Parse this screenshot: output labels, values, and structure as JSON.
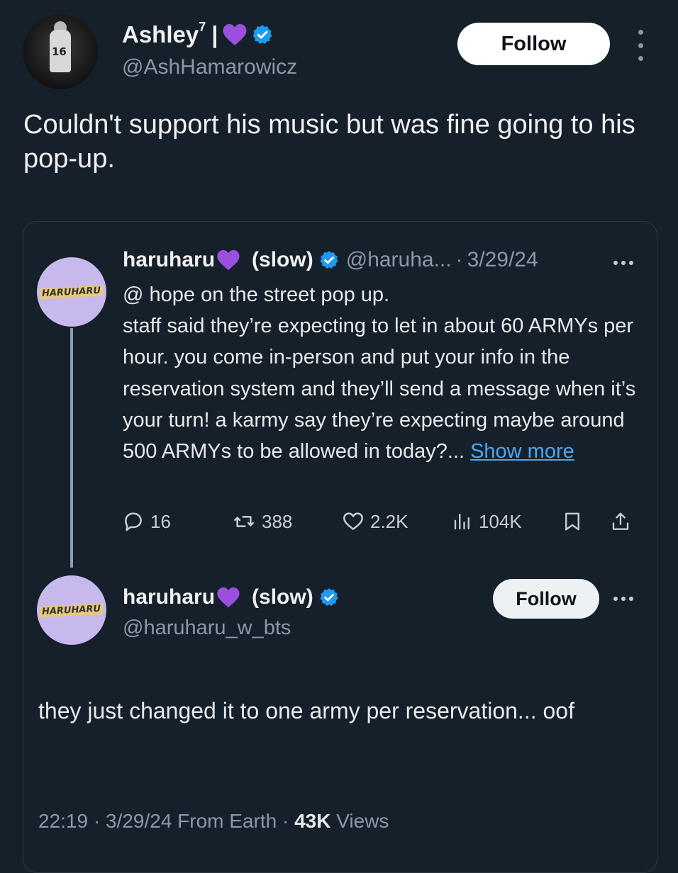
{
  "author": {
    "name": "Ashley",
    "superscript": "7",
    "separator": "|",
    "handle": "@AshHamarowicz",
    "avatar_text": "16",
    "follow_label": "Follow"
  },
  "tweet": {
    "text": "Couldn't support his music but was fine going to his pop-up.",
    "meta": {
      "time": "22:19",
      "date": "3/29/24",
      "source": "From Earth",
      "views_count": "43K",
      "views_label": "Views"
    }
  },
  "quoted": {
    "first": {
      "name": "haruharu",
      "name_suffix": "(slow)",
      "handle": "@haruha...",
      "date": "3/29/24",
      "avatar_text": "HARUHARU",
      "body": "@ hope on the street pop up.\nstaff said they’re expecting to let in about 60 ARMYs per hour. you come in-person and put your info in the reservation system and they’ll send a message when it’s your turn! a karmy say they’re expecting maybe around 500 ARMYs to be allowed in today?...",
      "show_more": "Show more",
      "stats": {
        "replies": "16",
        "reposts": "388",
        "likes": "2.2K",
        "views": "104K"
      }
    },
    "second": {
      "name": "haruharu",
      "name_suffix": "(slow)",
      "handle": "@haruharu_w_bts",
      "avatar_text": "HARUHARU",
      "follow_label": "Follow",
      "body": "they just changed it to one army per reservation... oof"
    }
  },
  "icons": {
    "verified": "verified-badge-icon",
    "heart_emoji": "purple-heart-icon",
    "more": "more-dots-icon",
    "reply": "reply-icon",
    "repost": "repost-icon",
    "like": "like-icon",
    "views": "views-chart-icon",
    "bookmark": "bookmark-icon",
    "share": "share-icon"
  },
  "colors": {
    "background": "#15202b",
    "verified": "#1d9bf0",
    "purple_heart": "#9b4fdc",
    "link": "#4ea5f0"
  }
}
